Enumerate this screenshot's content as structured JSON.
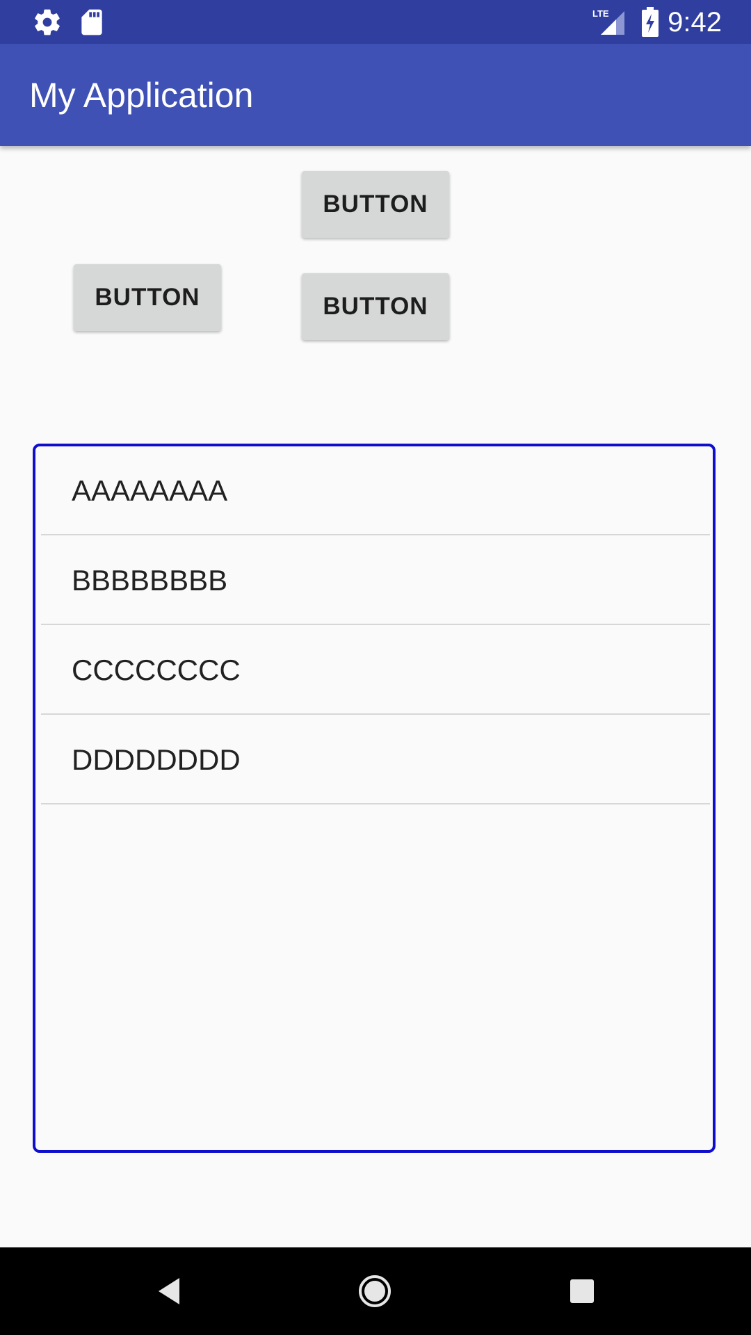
{
  "status_bar": {
    "time": "9:42",
    "network_label": "LTE",
    "icons": [
      "settings-icon",
      "sd-card-icon",
      "lte-signal-icon",
      "battery-charging-icon"
    ]
  },
  "app_bar": {
    "title": "My Application",
    "color": "#3f51b5",
    "status_color": "#303f9f"
  },
  "buttons": [
    {
      "label": "BUTTON"
    },
    {
      "label": "BUTTON"
    },
    {
      "label": "BUTTON"
    }
  ],
  "list": {
    "border_color": "#0e0ecc",
    "items": [
      {
        "label": "AAAAAAAA"
      },
      {
        "label": "BBBBBBBB"
      },
      {
        "label": "CCCCCCCC"
      },
      {
        "label": "DDDDDDDD"
      }
    ]
  },
  "nav_bar": {
    "icons": [
      "back-icon",
      "home-icon",
      "recents-icon"
    ]
  }
}
